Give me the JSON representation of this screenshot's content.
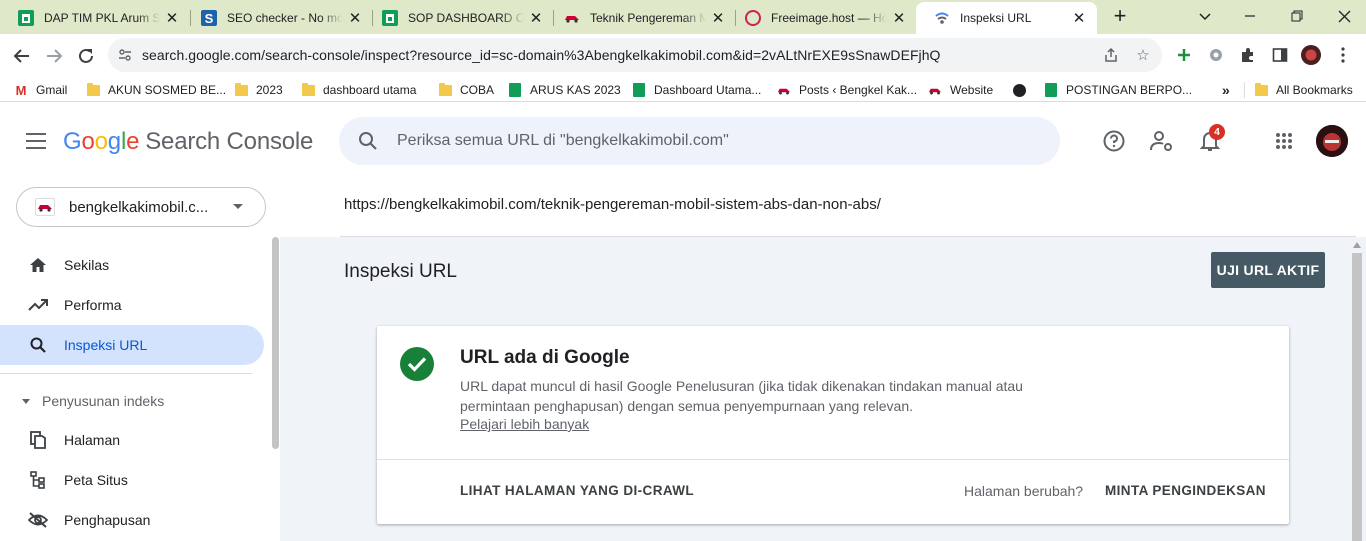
{
  "browser": {
    "tabs": [
      {
        "title": "DAP TIM PKL Arum Sa",
        "icon": "sheets-icon"
      },
      {
        "title": "SEO checker - No mo",
        "icon": "seo-icon"
      },
      {
        "title": "SOP DASHBOARD OP",
        "icon": "sheets-icon"
      },
      {
        "title": "Teknik Pengereman M",
        "icon": "car-icon"
      },
      {
        "title": "Freeimage.host — Ho",
        "icon": "freeimage-icon"
      },
      {
        "title": "Inspeksi URL",
        "icon": "search-console-icon",
        "active": true
      }
    ],
    "address": "search.google.com/search-console/inspect?resource_id=sc-domain%3Abengkelkakimobil.com&id=2vALtNrEXE9sSnawDEFjhQ",
    "bookmarks": [
      {
        "label": "Gmail",
        "icon": "gmail-icon"
      },
      {
        "label": "AKUN SOSMED BE...",
        "icon": "folder-icon"
      },
      {
        "label": "2023",
        "icon": "folder-icon"
      },
      {
        "label": "dashboard utama",
        "icon": "folder-icon"
      },
      {
        "label": "COBA",
        "icon": "folder-icon"
      },
      {
        "label": "ARUS KAS 2023",
        "icon": "sheets-icon"
      },
      {
        "label": "Dashboard Utama...",
        "icon": "sheets-icon"
      },
      {
        "label": "Posts ‹ Bengkel Kak...",
        "icon": "car-icon"
      },
      {
        "label": "Website",
        "icon": "car-icon"
      },
      {
        "label": "",
        "icon": "globe-icon"
      },
      {
        "label": "POSTINGAN BERPO...",
        "icon": "sheets-icon"
      }
    ],
    "more_bookmarks": "»",
    "all_bookmarks": "All Bookmarks"
  },
  "header": {
    "product_google": [
      "G",
      "o",
      "o",
      "g",
      "l",
      "e"
    ],
    "product_name": "Search Console",
    "search_placeholder": "Periksa semua URL di \"bengkelkakimobil.com\"",
    "notification_count": "4"
  },
  "sidebar": {
    "property": "bengkelkakimobil.c...",
    "items": [
      {
        "label": "Sekilas",
        "icon": "home-icon"
      },
      {
        "label": "Performa",
        "icon": "trending-icon"
      },
      {
        "label": "Inspeksi URL",
        "icon": "search-icon",
        "active": true
      }
    ],
    "section_title": "Penyusunan indeks",
    "section_items": [
      {
        "label": "Halaman",
        "icon": "pages-icon"
      },
      {
        "label": "Peta Situs",
        "icon": "sitemap-icon"
      },
      {
        "label": "Penghapusan",
        "icon": "removal-icon"
      }
    ]
  },
  "main": {
    "inspected_url": "https://bengkelkakimobil.com/teknik-pengereman-mobil-sistem-abs-dan-non-abs/",
    "page_title": "Inspeksi URL",
    "live_test_button": "UJI URL AKTIF",
    "card": {
      "title": "URL ada di Google",
      "description": "URL dapat muncul di hasil Google Penelusuran (jika tidak dikenakan tindakan manual atau permintaan penghapusan) dengan semua penyempurnaan yang relevan.",
      "learn_more": "Pelajari lebih banyak",
      "view_crawled": "LIHAT HALAMAN YANG DI-CRAWL",
      "page_changed": "Halaman berubah?",
      "request_indexing": "MINTA PENGINDEKSAN"
    }
  },
  "colors": {
    "accent": "#0b57d0",
    "active_nav_bg": "#d3e3fd",
    "success_green": "#188038",
    "live_button_bg": "#455a64",
    "chrome_frame": "#dfe8c8"
  }
}
